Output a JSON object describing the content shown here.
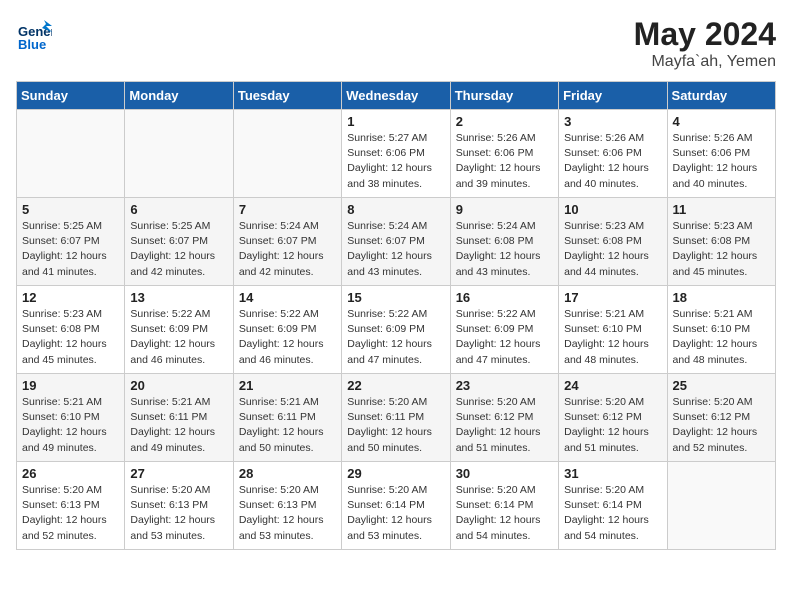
{
  "header": {
    "logo_line1": "General",
    "logo_line2": "Blue",
    "month_year": "May 2024",
    "location": "Mayfa`ah, Yemen"
  },
  "weekdays": [
    "Sunday",
    "Monday",
    "Tuesday",
    "Wednesday",
    "Thursday",
    "Friday",
    "Saturday"
  ],
  "weeks": [
    [
      {
        "day": "",
        "info": ""
      },
      {
        "day": "",
        "info": ""
      },
      {
        "day": "",
        "info": ""
      },
      {
        "day": "1",
        "info": "Sunrise: 5:27 AM\nSunset: 6:06 PM\nDaylight: 12 hours\nand 38 minutes."
      },
      {
        "day": "2",
        "info": "Sunrise: 5:26 AM\nSunset: 6:06 PM\nDaylight: 12 hours\nand 39 minutes."
      },
      {
        "day": "3",
        "info": "Sunrise: 5:26 AM\nSunset: 6:06 PM\nDaylight: 12 hours\nand 40 minutes."
      },
      {
        "day": "4",
        "info": "Sunrise: 5:26 AM\nSunset: 6:06 PM\nDaylight: 12 hours\nand 40 minutes."
      }
    ],
    [
      {
        "day": "5",
        "info": "Sunrise: 5:25 AM\nSunset: 6:07 PM\nDaylight: 12 hours\nand 41 minutes."
      },
      {
        "day": "6",
        "info": "Sunrise: 5:25 AM\nSunset: 6:07 PM\nDaylight: 12 hours\nand 42 minutes."
      },
      {
        "day": "7",
        "info": "Sunrise: 5:24 AM\nSunset: 6:07 PM\nDaylight: 12 hours\nand 42 minutes."
      },
      {
        "day": "8",
        "info": "Sunrise: 5:24 AM\nSunset: 6:07 PM\nDaylight: 12 hours\nand 43 minutes."
      },
      {
        "day": "9",
        "info": "Sunrise: 5:24 AM\nSunset: 6:08 PM\nDaylight: 12 hours\nand 43 minutes."
      },
      {
        "day": "10",
        "info": "Sunrise: 5:23 AM\nSunset: 6:08 PM\nDaylight: 12 hours\nand 44 minutes."
      },
      {
        "day": "11",
        "info": "Sunrise: 5:23 AM\nSunset: 6:08 PM\nDaylight: 12 hours\nand 45 minutes."
      }
    ],
    [
      {
        "day": "12",
        "info": "Sunrise: 5:23 AM\nSunset: 6:08 PM\nDaylight: 12 hours\nand 45 minutes."
      },
      {
        "day": "13",
        "info": "Sunrise: 5:22 AM\nSunset: 6:09 PM\nDaylight: 12 hours\nand 46 minutes."
      },
      {
        "day": "14",
        "info": "Sunrise: 5:22 AM\nSunset: 6:09 PM\nDaylight: 12 hours\nand 46 minutes."
      },
      {
        "day": "15",
        "info": "Sunrise: 5:22 AM\nSunset: 6:09 PM\nDaylight: 12 hours\nand 47 minutes."
      },
      {
        "day": "16",
        "info": "Sunrise: 5:22 AM\nSunset: 6:09 PM\nDaylight: 12 hours\nand 47 minutes."
      },
      {
        "day": "17",
        "info": "Sunrise: 5:21 AM\nSunset: 6:10 PM\nDaylight: 12 hours\nand 48 minutes."
      },
      {
        "day": "18",
        "info": "Sunrise: 5:21 AM\nSunset: 6:10 PM\nDaylight: 12 hours\nand 48 minutes."
      }
    ],
    [
      {
        "day": "19",
        "info": "Sunrise: 5:21 AM\nSunset: 6:10 PM\nDaylight: 12 hours\nand 49 minutes."
      },
      {
        "day": "20",
        "info": "Sunrise: 5:21 AM\nSunset: 6:11 PM\nDaylight: 12 hours\nand 49 minutes."
      },
      {
        "day": "21",
        "info": "Sunrise: 5:21 AM\nSunset: 6:11 PM\nDaylight: 12 hours\nand 50 minutes."
      },
      {
        "day": "22",
        "info": "Sunrise: 5:20 AM\nSunset: 6:11 PM\nDaylight: 12 hours\nand 50 minutes."
      },
      {
        "day": "23",
        "info": "Sunrise: 5:20 AM\nSunset: 6:12 PM\nDaylight: 12 hours\nand 51 minutes."
      },
      {
        "day": "24",
        "info": "Sunrise: 5:20 AM\nSunset: 6:12 PM\nDaylight: 12 hours\nand 51 minutes."
      },
      {
        "day": "25",
        "info": "Sunrise: 5:20 AM\nSunset: 6:12 PM\nDaylight: 12 hours\nand 52 minutes."
      }
    ],
    [
      {
        "day": "26",
        "info": "Sunrise: 5:20 AM\nSunset: 6:13 PM\nDaylight: 12 hours\nand 52 minutes."
      },
      {
        "day": "27",
        "info": "Sunrise: 5:20 AM\nSunset: 6:13 PM\nDaylight: 12 hours\nand 53 minutes."
      },
      {
        "day": "28",
        "info": "Sunrise: 5:20 AM\nSunset: 6:13 PM\nDaylight: 12 hours\nand 53 minutes."
      },
      {
        "day": "29",
        "info": "Sunrise: 5:20 AM\nSunset: 6:14 PM\nDaylight: 12 hours\nand 53 minutes."
      },
      {
        "day": "30",
        "info": "Sunrise: 5:20 AM\nSunset: 6:14 PM\nDaylight: 12 hours\nand 54 minutes."
      },
      {
        "day": "31",
        "info": "Sunrise: 5:20 AM\nSunset: 6:14 PM\nDaylight: 12 hours\nand 54 minutes."
      },
      {
        "day": "",
        "info": ""
      }
    ]
  ]
}
